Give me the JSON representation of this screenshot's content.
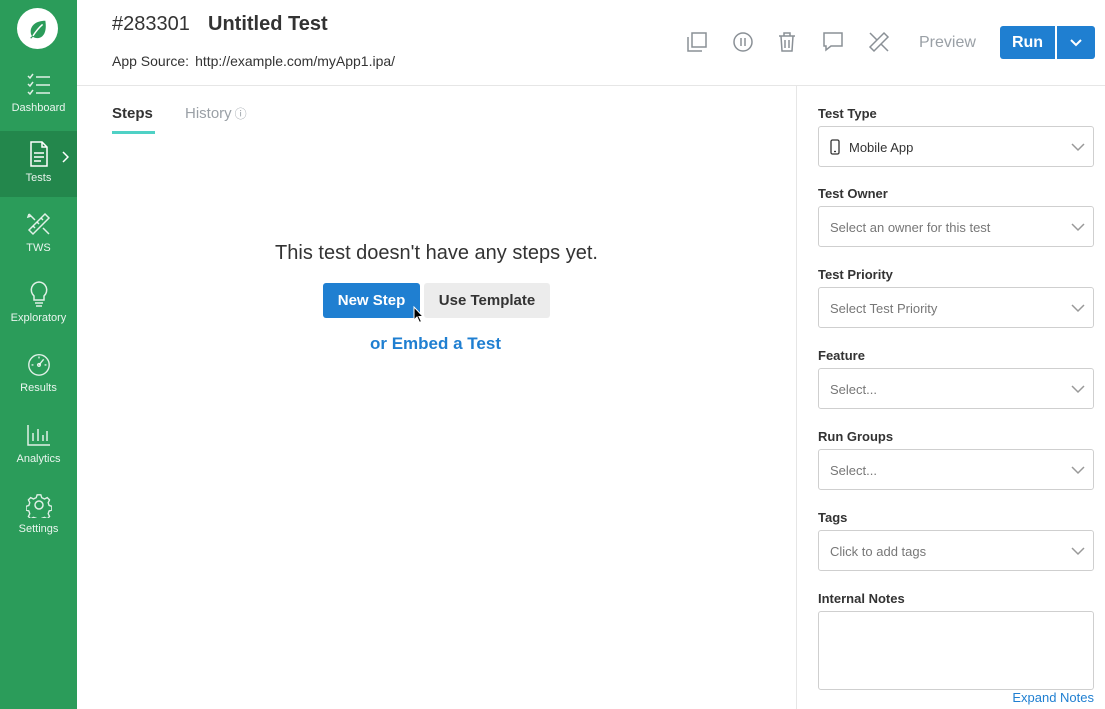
{
  "sidebar": {
    "items": [
      {
        "label": "Dashboard",
        "icon": "dashboard-icon"
      },
      {
        "label": "Tests",
        "icon": "document-icon",
        "active": true
      },
      {
        "label": "TWS",
        "icon": "tools-icon"
      },
      {
        "label": "Exploratory",
        "icon": "lightbulb-icon"
      },
      {
        "label": "Results",
        "icon": "gauge-icon"
      },
      {
        "label": "Analytics",
        "icon": "bar-chart-icon"
      },
      {
        "label": "Settings",
        "icon": "gear-icon"
      }
    ]
  },
  "header": {
    "test_id": "#283301",
    "title": "Untitled Test",
    "app_source_label": "App Source:",
    "app_source_url": "http://example.com/myApp1.ipa/",
    "preview_label": "Preview",
    "run_label": "Run"
  },
  "tabs": {
    "steps": "Steps",
    "history": "History",
    "history_info": "ⓘ"
  },
  "empty_state": {
    "message": "This test doesn't have any steps yet.",
    "new_step": "New Step",
    "use_template": "Use Template",
    "embed": "or Embed a Test"
  },
  "panel": {
    "test_type": {
      "label": "Test Type",
      "value": "Mobile App"
    },
    "test_owner": {
      "label": "Test Owner",
      "placeholder": "Select an owner for this test"
    },
    "test_priority": {
      "label": "Test Priority",
      "placeholder": "Select Test Priority"
    },
    "feature": {
      "label": "Feature",
      "placeholder": "Select..."
    },
    "run_groups": {
      "label": "Run Groups",
      "placeholder": "Select..."
    },
    "tags": {
      "label": "Tags",
      "placeholder": "Click to add tags"
    },
    "internal_notes": {
      "label": "Internal Notes",
      "value": ""
    },
    "expand_notes": "Expand Notes"
  },
  "colors": {
    "sidebar": "#2b9c5a",
    "sidebar_active": "#23874c",
    "primary": "#1f7fd1",
    "tab_underline": "#4fd1c5"
  }
}
